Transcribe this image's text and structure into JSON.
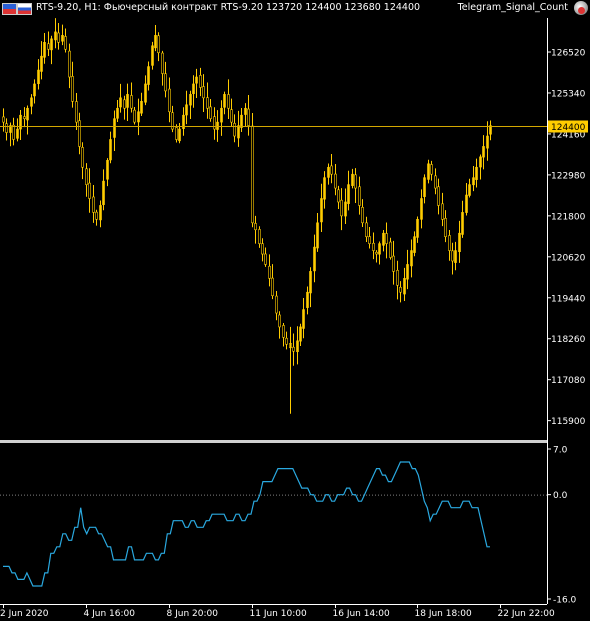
{
  "header": {
    "symbol_line": "RTS-9.20, H1:  Фьючерсный контракт RTS-9.20  123720 124400 123680 124400",
    "expert_name": "Telegram_Signal_Count",
    "flag_icons": [
      "ru-flag-icon",
      "us-flag-icon"
    ],
    "expert_icon": "robot-icon"
  },
  "colors": {
    "background": "#000000",
    "candle": "#ffcc00",
    "price_line": "#d4a800",
    "price_label_bg": "#ffcc00",
    "indicator": "#2aa9e0",
    "axis_text": "#ffffff",
    "separator": "#d0d0d0",
    "zero_line": "#7f7f7f"
  },
  "chart_data": [
    {
      "type": "candlestick",
      "title": "RTS-9.20, H1",
      "y_ticks": [
        "126520",
        "125340",
        "124160",
        "122980",
        "121800",
        "120620",
        "119440",
        "118260",
        "117080",
        "115900"
      ],
      "ylim": [
        115400,
        127500
      ],
      "current_price": "124400",
      "current_price_value": 124400,
      "x_ticks": [
        "2 Jun 2020",
        "4 Jun 16:00",
        "8 Jun 20:00",
        "11 Jun 10:00",
        "16 Jun 14:00",
        "18 Jun 18:00",
        "22 Jun 22:00"
      ],
      "x_tick_bars": [
        0,
        24,
        48,
        72,
        96,
        120,
        144
      ],
      "closes": [
        124500,
        124200,
        124400,
        124000,
        124300,
        124700,
        124600,
        124900,
        125200,
        125600,
        126000,
        126400,
        126800,
        126600,
        126900,
        127100,
        126800,
        127000,
        126600,
        125800,
        125100,
        124500,
        123800,
        123200,
        122700,
        122300,
        121900,
        121700,
        122100,
        122800,
        123400,
        124000,
        124600,
        124900,
        125200,
        124900,
        125300,
        124900,
        124500,
        124800,
        125100,
        125600,
        126100,
        126700,
        127000,
        126500,
        125900,
        125400,
        124800,
        124300,
        124000,
        124300,
        124700,
        125000,
        125300,
        125600,
        125800,
        125500,
        125200,
        124900,
        124600,
        124300,
        124500,
        124900,
        125300,
        124900,
        124500,
        124100,
        124400,
        124700,
        124900,
        124400,
        121600,
        121400,
        121000,
        120700,
        120400,
        120000,
        119500,
        119000,
        118600,
        118300,
        118100,
        118000,
        117900,
        118200,
        118600,
        119100,
        119600,
        120200,
        120900,
        121600,
        122300,
        122900,
        123200,
        123000,
        122600,
        122200,
        121800,
        122200,
        122700,
        123000,
        122600,
        122100,
        121600,
        121200,
        121000,
        120800,
        120700,
        121000,
        121300,
        121000,
        120600,
        120200,
        119800,
        119600,
        120000,
        120400,
        120800,
        121200,
        121700,
        122300,
        122900,
        123300,
        123000,
        122600,
        122100,
        121700,
        121200,
        120800,
        120500,
        120800,
        121300,
        121900,
        122400,
        122700,
        122900,
        123200,
        123500,
        123800,
        124100,
        124400
      ],
      "indicator": {
        "y_ticks": [
          "7.0",
          "0.0",
          "-16.0"
        ],
        "ylim": [
          -16,
          7
        ],
        "values": [
          -11,
          -11,
          -11,
          -12,
          -12,
          -13,
          -13,
          -13,
          -12,
          -13,
          -14,
          -14,
          -14,
          -14,
          -12,
          -12,
          -9,
          -9,
          -8,
          -8,
          -6,
          -6,
          -7,
          -7,
          -5,
          -5,
          -2,
          -5,
          -6,
          -5,
          -5,
          -5,
          -6,
          -6,
          -7,
          -8,
          -8,
          -10,
          -10,
          -10,
          -10,
          -10,
          -8,
          -8,
          -10,
          -10,
          -10,
          -10,
          -9,
          -9,
          -9,
          -10,
          -10,
          -9,
          -9,
          -6,
          -6,
          -4,
          -4,
          -4,
          -4,
          -5,
          -5,
          -4,
          -4,
          -5,
          -5,
          -5,
          -4,
          -4,
          -3,
          -3,
          -3,
          -3,
          -3,
          -4,
          -4,
          -4,
          -3,
          -3,
          -4,
          -4,
          -3,
          -3,
          -1,
          -1,
          0,
          2,
          2,
          2,
          2,
          3,
          4,
          4,
          4,
          4,
          4,
          4,
          3,
          2,
          1,
          1,
          1,
          0,
          0,
          -1,
          -1,
          -1,
          0,
          0,
          -1,
          -1,
          0,
          0,
          0,
          1,
          1,
          0,
          0,
          -1,
          -1,
          0,
          1,
          2,
          3,
          4,
          4,
          3,
          3,
          2,
          2,
          3,
          4,
          5,
          5,
          5,
          5,
          4,
          4,
          3,
          1,
          -1,
          -2,
          -4,
          -3,
          -3,
          -2,
          -1,
          -1,
          -1,
          -2,
          -2,
          -2,
          -2,
          -1,
          -1,
          -1,
          -2,
          -2,
          -2,
          -4,
          -6,
          -8,
          -8
        ]
      }
    }
  ]
}
